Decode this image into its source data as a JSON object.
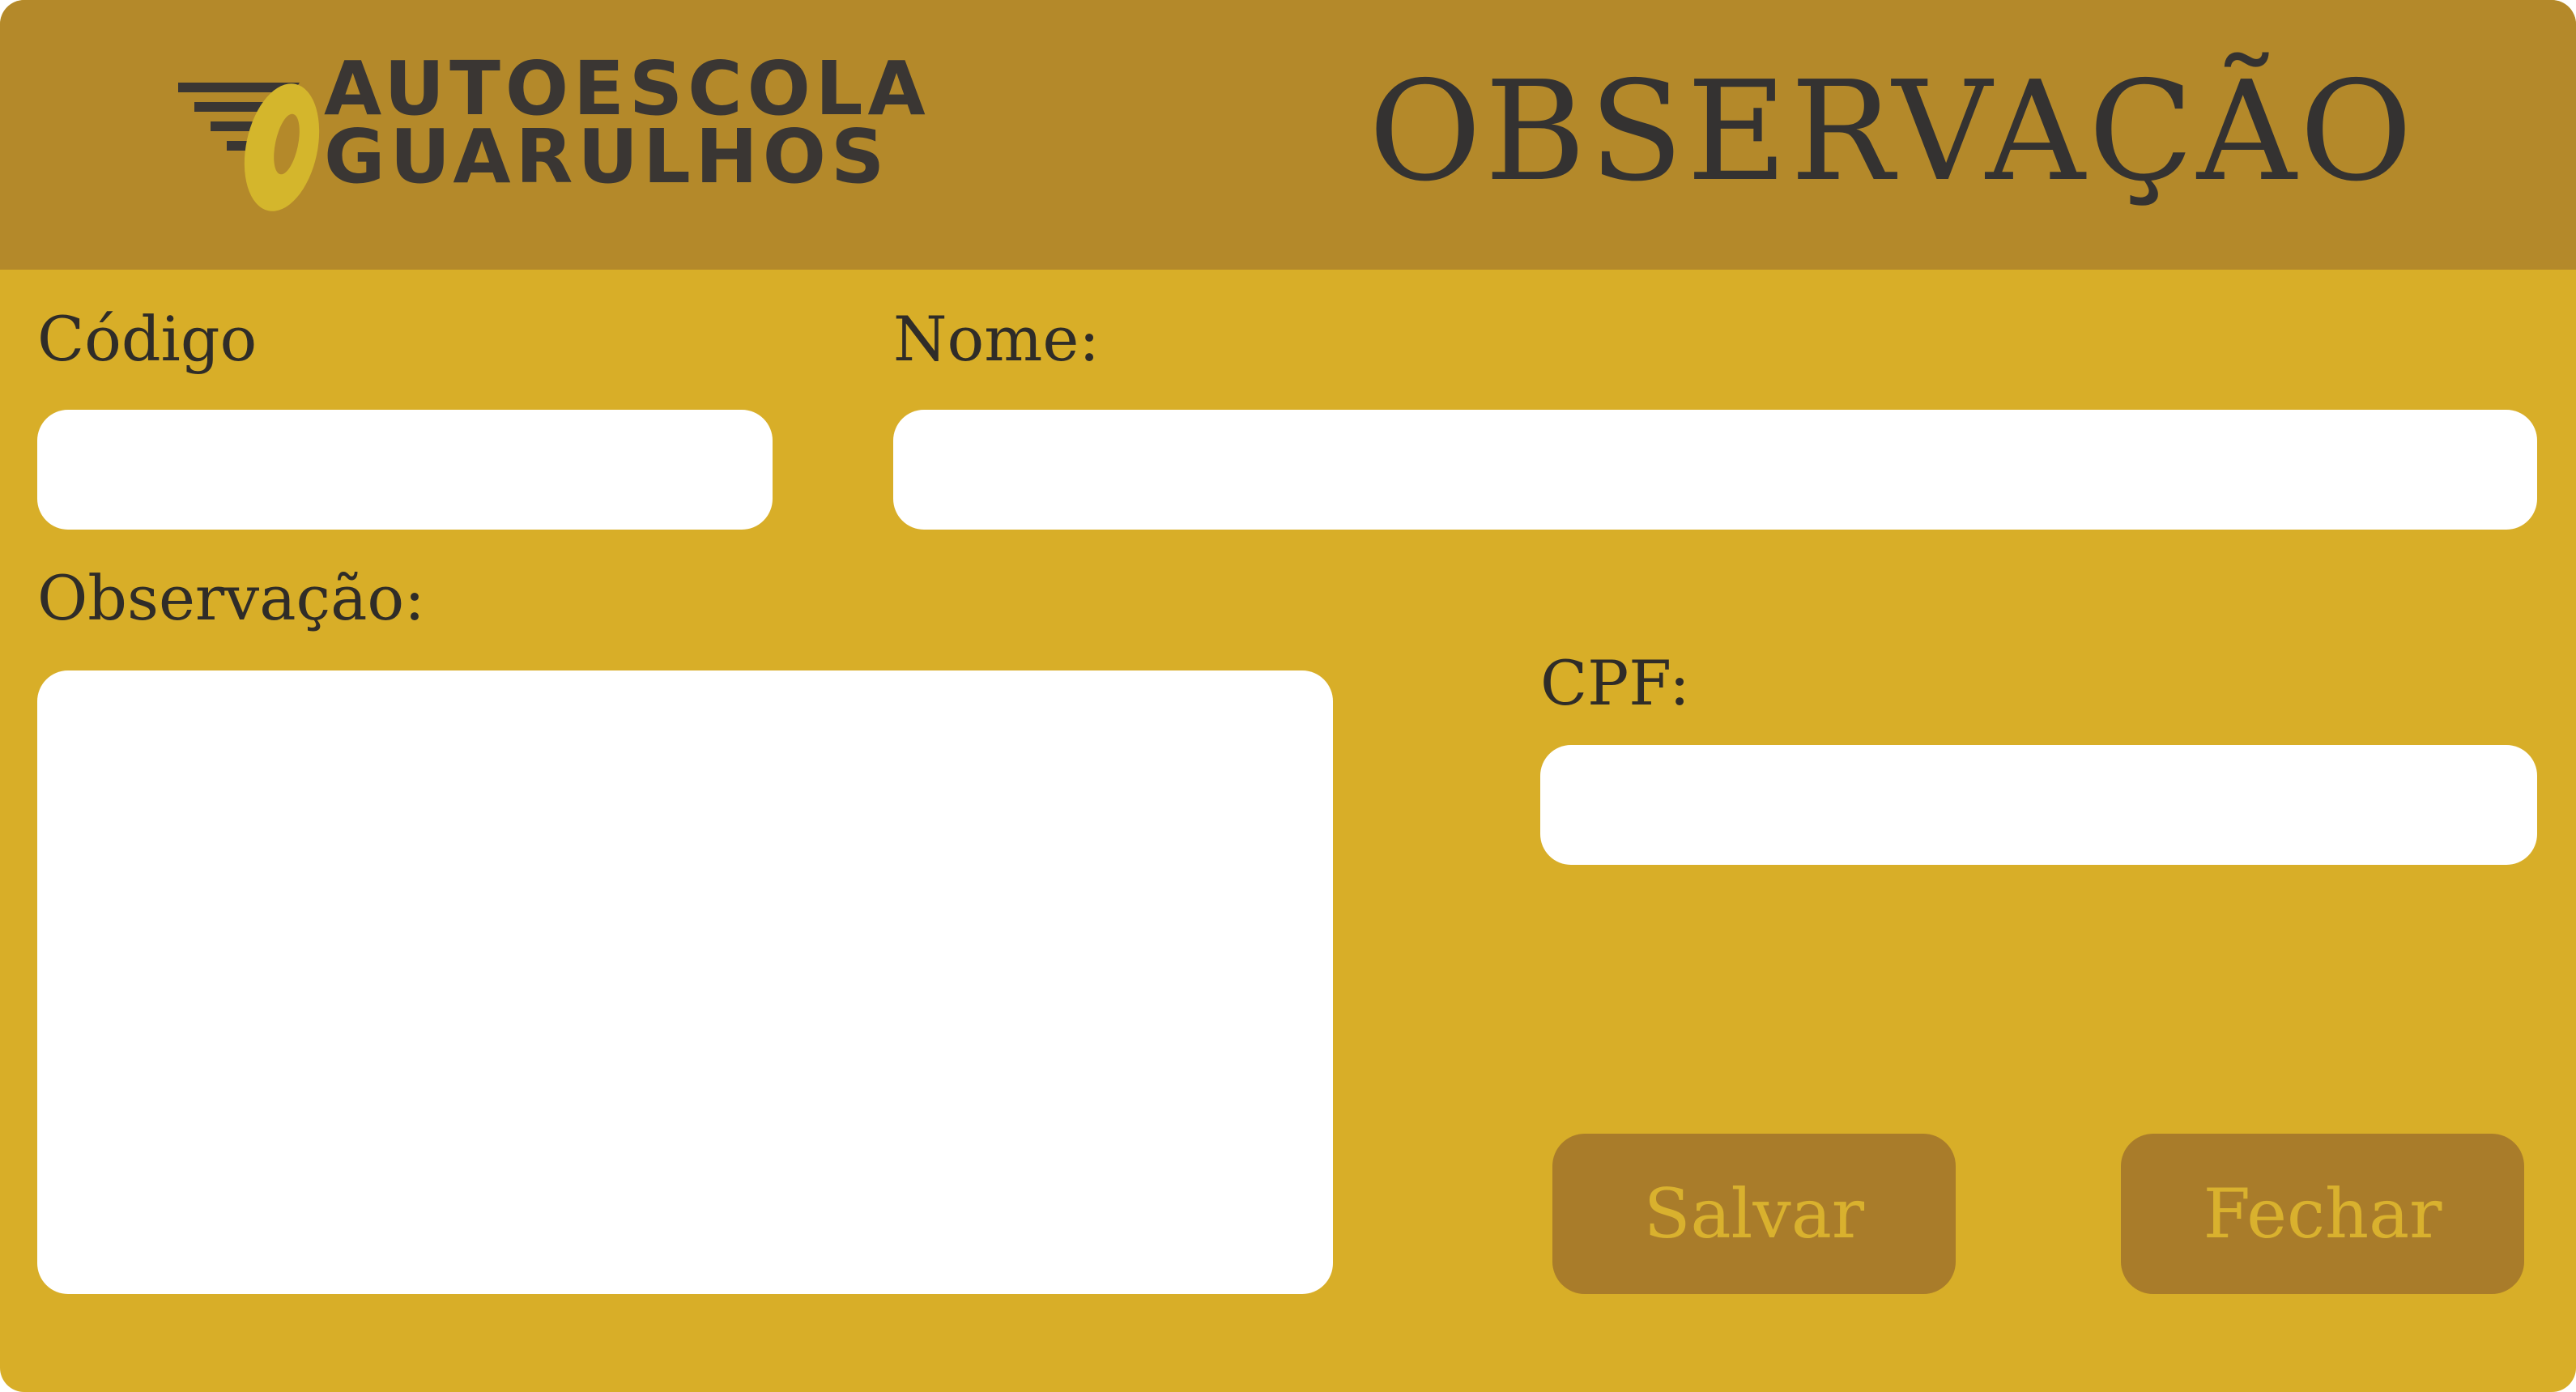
{
  "header": {
    "logo": {
      "line1": "AUTOESCOLA",
      "line2": "GUARULHOS"
    },
    "title": "OBSERVAÇÃO"
  },
  "form": {
    "codigo_label": "Código",
    "codigo_value": "",
    "nome_label": "Nome:",
    "nome_value": "",
    "observacao_label": "Observação:",
    "observacao_value": "",
    "cpf_label": "CPF:",
    "cpf_value": ""
  },
  "buttons": {
    "save_label": "Salvar",
    "close_label": "Fechar"
  },
  "colors": {
    "background": "#d8ae28",
    "header": "#b4892a",
    "button": "#a97c2a",
    "button_text": "#d9b12e",
    "text": "#2f2c28"
  }
}
